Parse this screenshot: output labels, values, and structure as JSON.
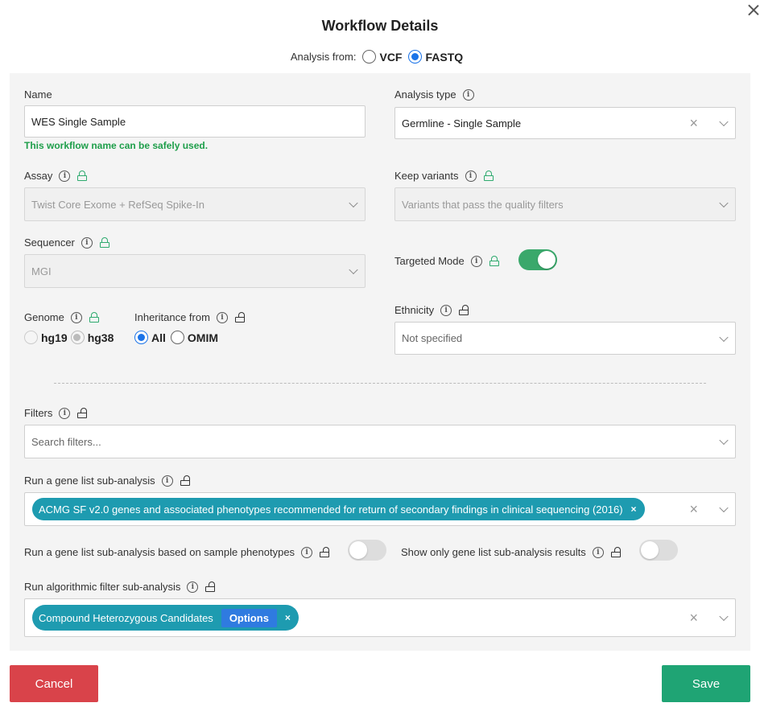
{
  "dialog": {
    "title": "Workflow Details",
    "close_icon": "close-icon"
  },
  "analysis_from": {
    "label": "Analysis from:",
    "options": [
      {
        "label": "VCF",
        "selected": false
      },
      {
        "label": "FASTQ",
        "selected": true
      }
    ]
  },
  "name": {
    "label": "Name",
    "value": "WES Single Sample",
    "validation": "This workflow name can be safely used."
  },
  "analysis_type": {
    "label": "Analysis type",
    "value": "Germline - Single Sample"
  },
  "assay": {
    "label": "Assay",
    "value": "Twist Core Exome + RefSeq Spike-In"
  },
  "keep_variants": {
    "label": "Keep variants",
    "value": "Variants that pass the quality filters"
  },
  "sequencer": {
    "label": "Sequencer",
    "value": "MGI"
  },
  "targeted_mode": {
    "label": "Targeted Mode",
    "enabled": true
  },
  "genome": {
    "label": "Genome",
    "options": [
      {
        "label": "hg19",
        "selected": false
      },
      {
        "label": "hg38",
        "selected": true
      }
    ]
  },
  "inheritance": {
    "label": "Inheritance from",
    "options": [
      {
        "label": "All",
        "selected": true
      },
      {
        "label": "OMIM",
        "selected": false
      }
    ]
  },
  "ethnicity": {
    "label": "Ethnicity",
    "value": "Not specified"
  },
  "filters": {
    "label": "Filters",
    "placeholder": "Search filters..."
  },
  "gene_list": {
    "label": "Run a gene list sub-analysis",
    "tag": "ACMG SF v2.0 genes and associated phenotypes recommended for return of secondary findings in clinical sequencing (2016)",
    "tag_remove": "×"
  },
  "phenotype_sub": {
    "label": "Run a gene list sub-analysis based on sample phenotypes",
    "enabled": false
  },
  "only_results": {
    "label": "Show only gene list sub-analysis results",
    "enabled": false
  },
  "algorithmic": {
    "label": "Run algorithmic filter sub-analysis",
    "tag": "Compound Heterozygous Candidates",
    "tag_button": "Options",
    "tag_remove": "×"
  },
  "clear_symbol": "×",
  "info_symbol": "i",
  "buttons": {
    "cancel": "Cancel",
    "save": "Save"
  },
  "colors": {
    "cancel": "#d9434a",
    "save": "#1fa474",
    "tag": "#1e9bb0",
    "toggle_on": "#3aa86b",
    "success": "#1e9e4a"
  }
}
